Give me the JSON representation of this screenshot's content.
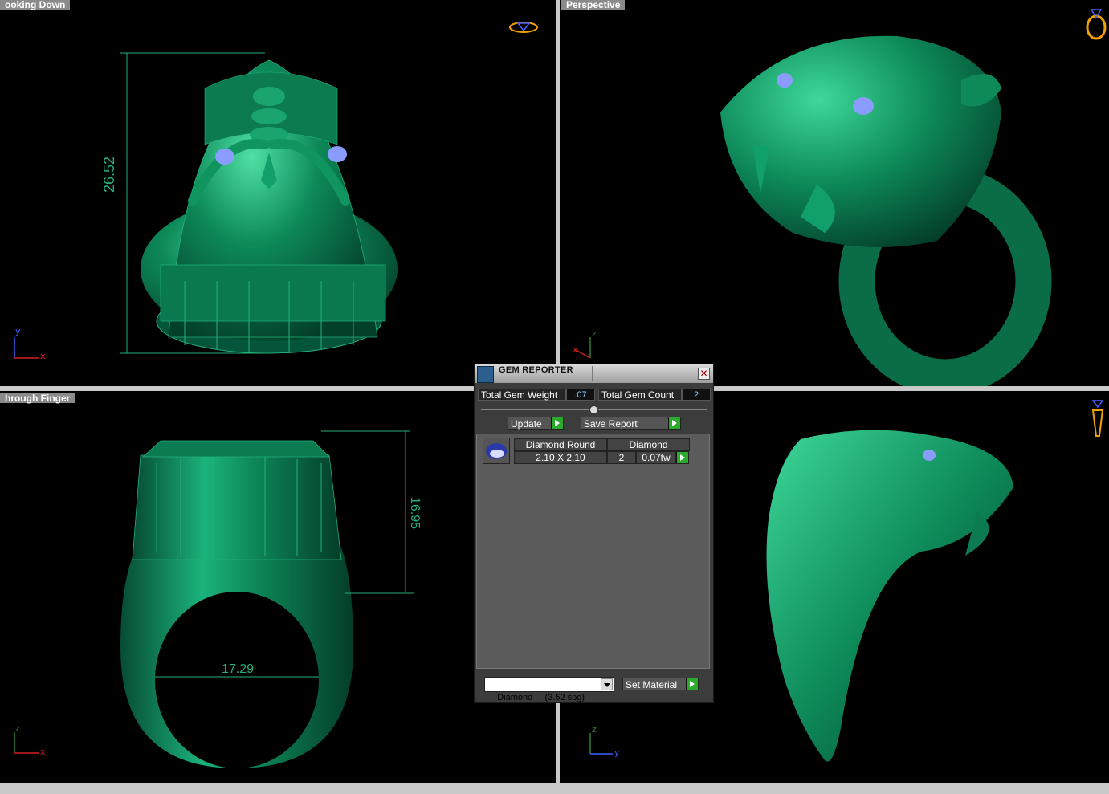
{
  "viewports": {
    "top_left": {
      "label": "ooking Down",
      "dimension": "26.52",
      "axis_vertical": "y",
      "axis_horizontal": "x"
    },
    "top_right": {
      "label": "Perspective",
      "axis_vertical": "z",
      "axis_horizontal": "x"
    },
    "bottom_left": {
      "label": "hrough Finger",
      "dimension_height": "16.95",
      "dimension_width": "17.29",
      "axis_vertical": "z",
      "axis_horizontal": "x"
    },
    "bottom_right": {
      "label": "",
      "axis_vertical": "z",
      "axis_horizontal": "y"
    }
  },
  "gem_reporter": {
    "title": "GEM REPORTER",
    "close_glyph": "✕",
    "total_weight_label": "Total Gem Weight",
    "total_weight_value": ".07",
    "total_count_label": "Total Gem Count",
    "total_count_value": "2",
    "update_label": "Update",
    "save_report_label": "Save Report",
    "gems": [
      {
        "shape": "Diamond Round",
        "size": "2.10 X 2.10",
        "material": "Diamond",
        "count": "2",
        "weight": "0.07tw"
      }
    ],
    "material_select_value": "Diamond     (3.52 spg)",
    "set_material_label": "Set Material"
  },
  "colors": {
    "model_green": "#0a7a4e",
    "wire_green": "#22b07a",
    "gem_blue": "#8a9dff",
    "icon_orange": "#f0a000"
  },
  "icons": [
    "ring-top-view-icon",
    "ring-perspective-icon",
    "ring-side-view-icon",
    "gem-reporter-app-icon",
    "play-arrow-icon",
    "close-icon",
    "dropdown-arrow-icon",
    "round-gem-icon"
  ]
}
